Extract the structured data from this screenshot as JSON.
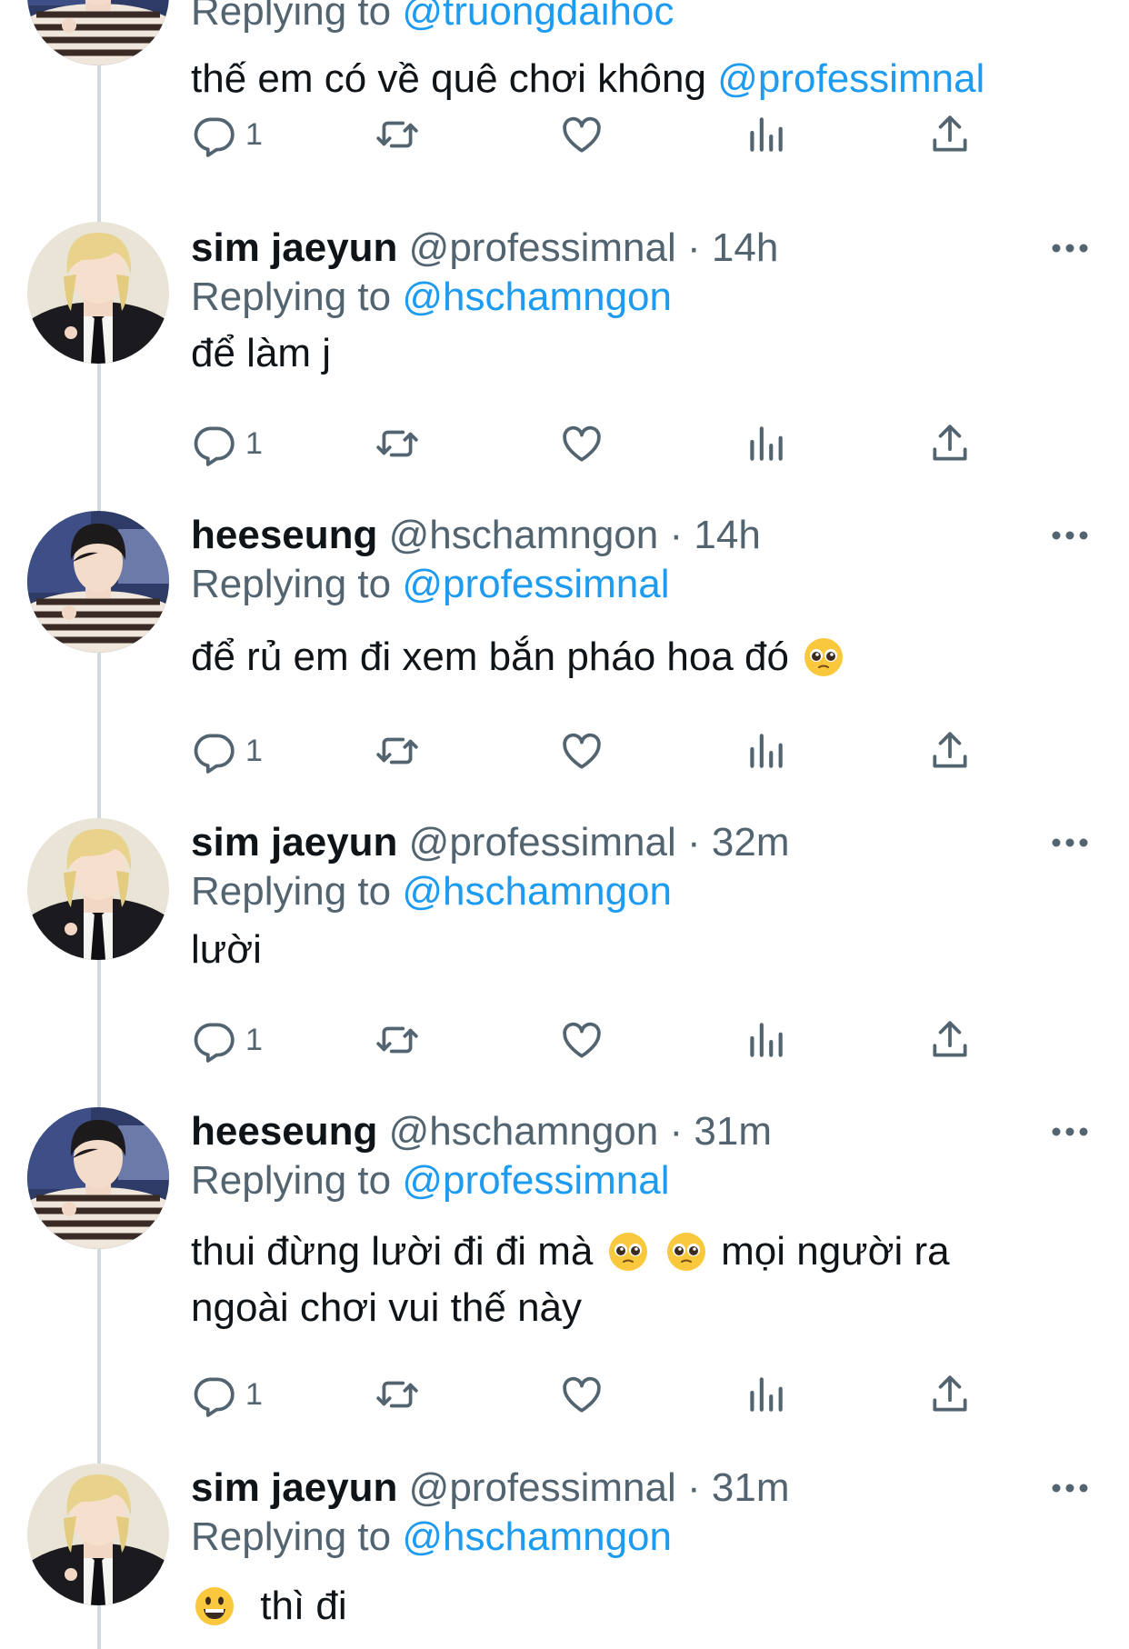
{
  "colors": {
    "link": "#1d9bf0",
    "secondary": "#536471",
    "text": "#0f1419",
    "thread": "#cfd9de"
  },
  "top_tweet": {
    "reply_prefix": "Replying to",
    "reply_mention": "@truongdaihoc",
    "text": "thế em có về quê chơi không",
    "text_mention": "@professimnal",
    "reply_count": "1"
  },
  "tweets": [
    {
      "name": "sim jaeyun",
      "handle": "@professimnal",
      "dot": "·",
      "time": "14h",
      "reply_prefix": "Replying to",
      "reply_mention": "@hschamngon",
      "text": "để làm j",
      "reply_count": "1"
    },
    {
      "name": "heeseung",
      "handle": "@hschamngon",
      "dot": "·",
      "time": "14h",
      "reply_prefix": "Replying to",
      "reply_mention": "@professimnal",
      "text": "để rủ em đi xem bắn pháo hoa đó",
      "reply_count": "1"
    },
    {
      "name": "sim jaeyun",
      "handle": "@professimnal",
      "dot": "·",
      "time": "32m",
      "reply_prefix": "Replying to",
      "reply_mention": "@hschamngon",
      "text": "lười",
      "reply_count": "1"
    },
    {
      "name": "heeseung",
      "handle": "@hschamngon",
      "dot": "·",
      "time": "31m",
      "reply_prefix": "Replying to",
      "reply_mention": "@professimnal",
      "text_a": "thui đừng lười đi đi mà",
      "text_b": "mọi người ra",
      "text_c": "ngoài chơi vui thế này",
      "reply_count": "1"
    },
    {
      "name": "sim jaeyun",
      "handle": "@professimnal",
      "dot": "·",
      "time": "31m",
      "reply_prefix": "Replying to",
      "reply_mention": "@hschamngon",
      "text": "thì đi"
    }
  ],
  "icons": [
    "reply-icon",
    "retweet-icon",
    "like-icon",
    "analytics-icon",
    "share-icon",
    "more-icon",
    "pleading-face-emoji",
    "grinning-face-emoji"
  ]
}
